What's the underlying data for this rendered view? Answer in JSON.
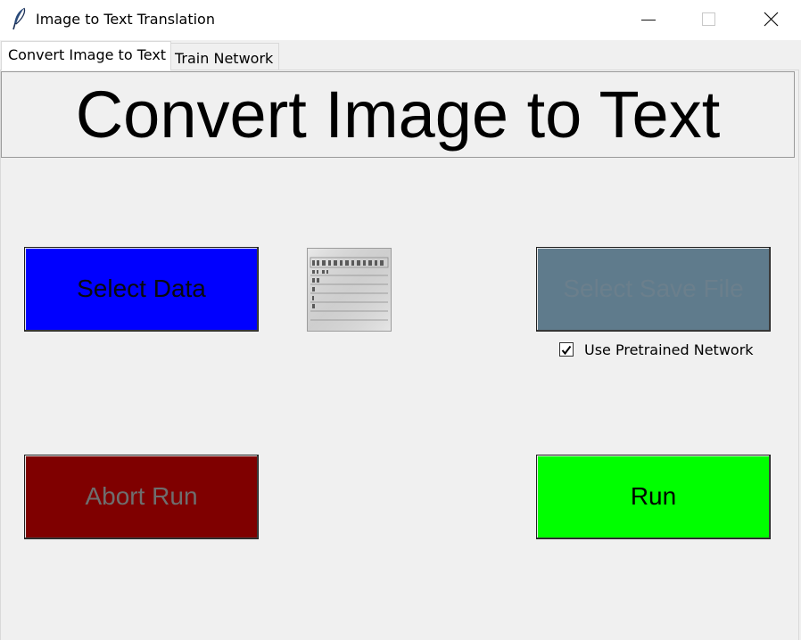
{
  "window": {
    "title": "Image to Text Translation",
    "controls": [
      "minimize-icon",
      "maximize-icon",
      "close-icon"
    ]
  },
  "tabs": [
    {
      "label": "Convert Image to Text",
      "active": true
    },
    {
      "label": "Train Network",
      "active": false
    }
  ],
  "main": {
    "heading": "Convert Image to Text",
    "select_data_label": "Select Data",
    "select_save_label": "Select Save File",
    "use_pretrained_label": "Use Pretrained Network",
    "use_pretrained_checked": true,
    "abort_label": "Abort Run",
    "run_label": "Run"
  },
  "colors": {
    "select_data_bg": "#0000ff",
    "select_save_bg": "#5f7b8c",
    "abort_bg": "#7f0000",
    "run_bg": "#00ff00",
    "window_bg": "#f0f0f0"
  }
}
